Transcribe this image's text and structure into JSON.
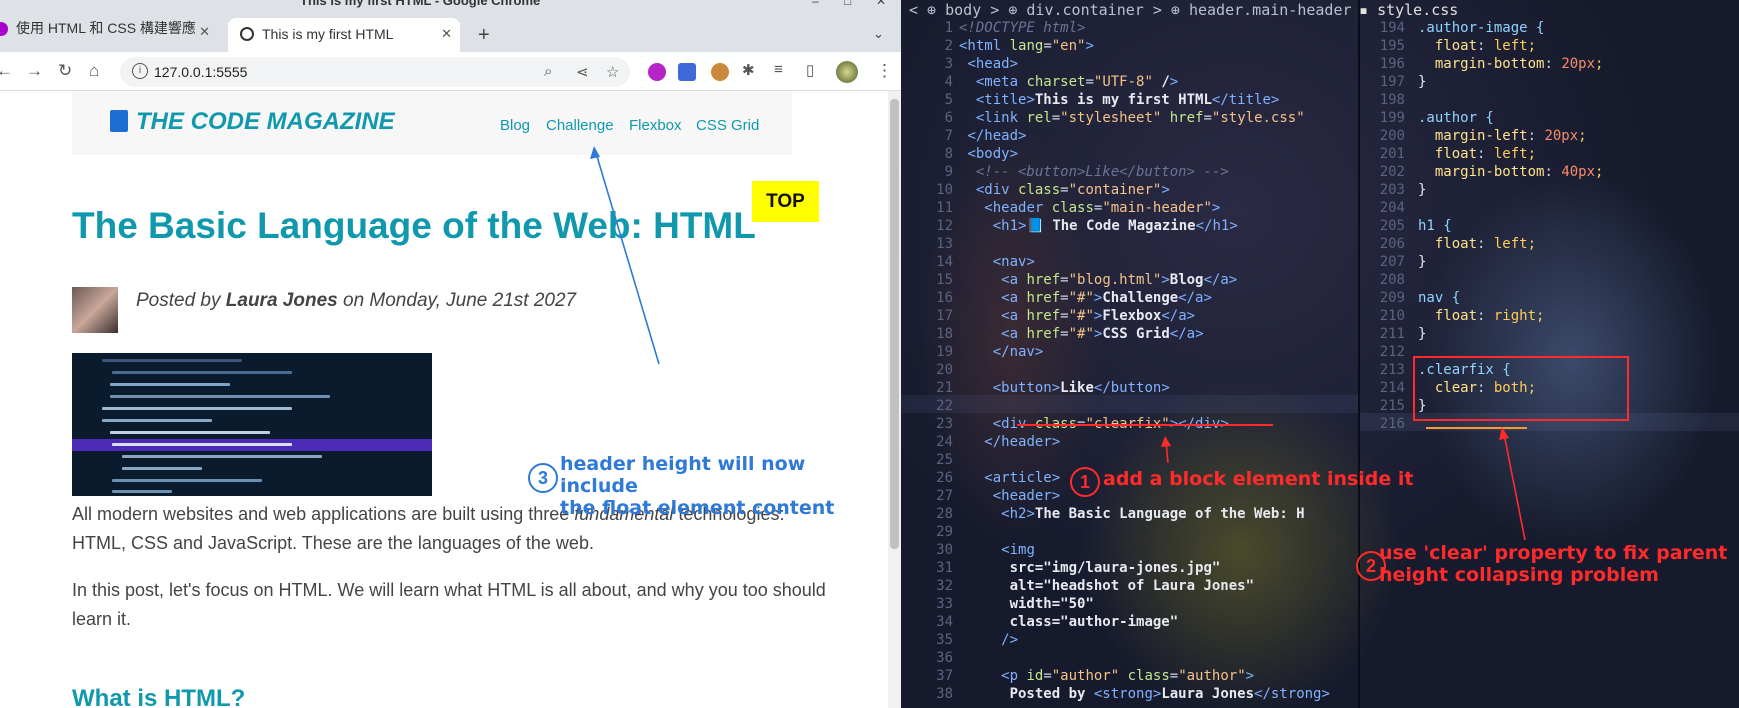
{
  "browser": {
    "window_title": "This is my first HTML - Google Chrome",
    "tabs": [
      {
        "label": "使用 HTML 和 CSS 構建響應",
        "active": false
      },
      {
        "label": "This is my first HTML",
        "active": true
      }
    ],
    "new_tab": "+",
    "url": "127.0.0.1:5555",
    "colors": {
      "accent": "#1098ad",
      "top_button": "#ffff00",
      "annotation_blue": "#2f7ad8"
    }
  },
  "page": {
    "logo": "THE CODE MAGAZINE",
    "nav": [
      "Blog",
      "Challenge",
      "Flexbox",
      "CSS Grid"
    ],
    "top_button": "TOP",
    "title": "The Basic Language of the Web: HTML",
    "byline": {
      "prefix": "Posted by ",
      "author": "Laura Jones",
      "suffix": " on Monday, June 21st 2027"
    },
    "para1_a": "All modern websites and web applications are built using three ",
    "para1_em": "fundamental",
    "para1_b": " technologies: HTML, CSS and JavaScript. These are the languages of the web.",
    "para2": "In this post, let's focus on HTML. We will learn what HTML is all about, and why you too should learn it.",
    "h3": "What is HTML?"
  },
  "annotations": {
    "a1_num": "1",
    "a1_text": "add a block element inside it",
    "a2_num": "2",
    "a2_line1": "use 'clear' property to fix parent",
    "a2_line2": "height collapsing problem",
    "a3_num": "3",
    "a3_line1": "header height will now include",
    "a3_line2": "the float element content",
    "colors": {
      "red": "#ff2b2b",
      "blue": "#2f7ad8"
    }
  },
  "editor": {
    "breadcrumb": "< ⊕ body > ⊕ div.container > ⊕ header.main-header",
    "css_tab": "style.css",
    "html_lines": [
      "<!DOCTYPE html>",
      "<html lang=\"en\">",
      "<head>",
      "<meta charset=\"UTF-8\" />",
      "<title>This is my first HTML</title>",
      "<link rel=\"stylesheet\" href=\"style.css\"",
      "</head>",
      "<body>",
      "<!-- <button>Like</button> -->",
      "<div class=\"container\">",
      "<header class=\"main-header\">",
      "<h1>📘 The Code Magazine</h1>",
      "",
      "<nav>",
      "<a href=\"blog.html\">Blog</a>",
      "<a href=\"#\">Challenge</a>",
      "<a href=\"#\">Flexbox</a>",
      "<a href=\"#\">CSS Grid</a>",
      "</nav>",
      "",
      "<button>Like</button>",
      "",
      "<div class=\"clearfix\"></div>",
      "</header>",
      "",
      "<article>",
      "<header>",
      "<h2>The Basic Language of the Web: H",
      "",
      "<img",
      "src=\"img/laura-jones.jpg\"",
      "alt=\"headshot of Laura Jones\"",
      "width=\"50\"",
      "class=\"author-image\"",
      "/>",
      "",
      "<p id=\"author\" class=\"author\">",
      "Posted by <strong>Laura Jones</strong>"
    ],
    "css_lines": [
      ".author-image {",
      "float: left;",
      "margin-bottom: 20px;",
      "}",
      "",
      ".author {",
      "margin-left: 20px;",
      "float: left;",
      "margin-bottom: 40px;",
      "}",
      "",
      "h1 {",
      "float: left;",
      "}",
      "",
      "nav {",
      "float: right;",
      "}",
      "",
      ".clearfix {",
      "clear: both;",
      "}",
      ""
    ]
  }
}
